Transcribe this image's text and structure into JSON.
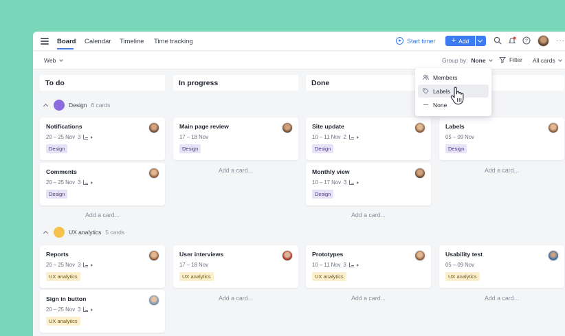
{
  "header": {
    "tabs": [
      {
        "label": "Board",
        "active": true
      },
      {
        "label": "Calendar",
        "active": false
      },
      {
        "label": "Timeline",
        "active": false
      },
      {
        "label": "Time tracking",
        "active": false
      }
    ],
    "start_timer": "Start timer",
    "add_label": "Add",
    "more": "···"
  },
  "toolbar": {
    "view_select": "Web",
    "group_by_label": "Group by:",
    "group_by_value": "None",
    "filter": "Filter",
    "all_cards": "All cards"
  },
  "dropdown": {
    "items": [
      {
        "label": "Members",
        "icon": "members-icon"
      },
      {
        "label": "Labels",
        "icon": "tag-icon"
      },
      {
        "label": "None",
        "icon": "dash-icon"
      }
    ]
  },
  "columns": [
    {
      "title": "To do"
    },
    {
      "title": "In progress"
    },
    {
      "title": "Done"
    },
    {
      "title": ""
    }
  ],
  "groups": [
    {
      "name": "Design",
      "count": "6 cards",
      "color": "#8b6be0"
    },
    {
      "name": "UX analytics",
      "count": "5 cards",
      "color": "#f6c24a"
    }
  ],
  "cards": {
    "design_todo": [
      {
        "title": "Notifications",
        "dates": "20 – 25 Nov",
        "subtasks": "3",
        "tag": "Design"
      },
      {
        "title": "Comments",
        "dates": "20 – 25 Nov",
        "subtasks": "3",
        "tag": "Design"
      }
    ],
    "design_progress": [
      {
        "title": "Main page review",
        "dates": "17 – 18 Nov",
        "tag": "Design"
      }
    ],
    "design_done": [
      {
        "title": "Site update",
        "dates": "10 – 11 Nov",
        "subtasks": "2",
        "tag": "Design"
      },
      {
        "title": "Monthly view",
        "dates": "10 – 17 Nov",
        "subtasks": "3",
        "tag": "Design"
      }
    ],
    "design_col4": [
      {
        "title": "Labels",
        "dates": "05 – 09 Nov",
        "tag": "Design"
      }
    ],
    "ux_todo": [
      {
        "title": "Reports",
        "dates": "20 – 25 Nov",
        "subtasks": "3",
        "tag": "UX analytics"
      },
      {
        "title": "Sign in button",
        "dates": "20 – 25 Nov",
        "subtasks": "3",
        "tag": "UX analytics"
      }
    ],
    "ux_progress": [
      {
        "title": "User interviews",
        "dates": "17 – 18 Nov",
        "tag": "UX analytics"
      }
    ],
    "ux_done": [
      {
        "title": "Prototypes",
        "dates": "10 – 11 Nov",
        "subtasks": "3",
        "tag": "UX analytics"
      }
    ],
    "ux_col4": [
      {
        "title": "Usability test",
        "dates": "05 – 09 Nov",
        "tag": "UX analytics"
      }
    ]
  },
  "add_card_label": "Add a card..."
}
